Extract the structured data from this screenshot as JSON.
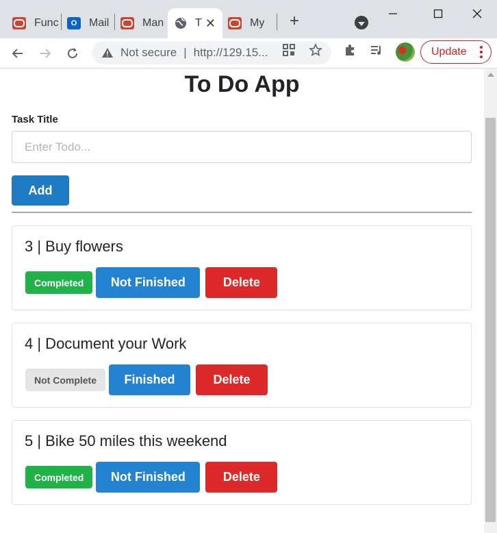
{
  "browser": {
    "tabs": [
      {
        "title": "Func",
        "favicon": "oracle-icon"
      },
      {
        "title": "Mail",
        "favicon": "outlook-icon"
      },
      {
        "title": "Man",
        "favicon": "oracle-icon"
      },
      {
        "title": "T",
        "favicon": "globe-icon",
        "active": true
      },
      {
        "title": "My",
        "favicon": "oracle-icon"
      }
    ],
    "security_label": "Not secure",
    "url": "http://129.15...",
    "update_label": "Update"
  },
  "app": {
    "title": "To Do App",
    "field_label": "Task Title",
    "input_value": "",
    "input_placeholder": "Enter Todo...",
    "add_label": "Add"
  },
  "todos": [
    {
      "title": "3 | Buy flowers",
      "status": "Completed",
      "toggle_label": "Not Finished",
      "delete_label": "Delete"
    },
    {
      "title": "4 | Document your Work",
      "status": "Not Complete",
      "toggle_label": "Finished",
      "delete_label": "Delete"
    },
    {
      "title": "5 | Bike 50 miles this weekend",
      "status": "Completed",
      "toggle_label": "Not Finished",
      "delete_label": "Delete"
    }
  ],
  "colors": {
    "primary": "#1e7bc4",
    "toggle": "#2483d1",
    "danger": "#dc2a2a",
    "success": "#21b24a",
    "muted": "#e5e5e5"
  }
}
